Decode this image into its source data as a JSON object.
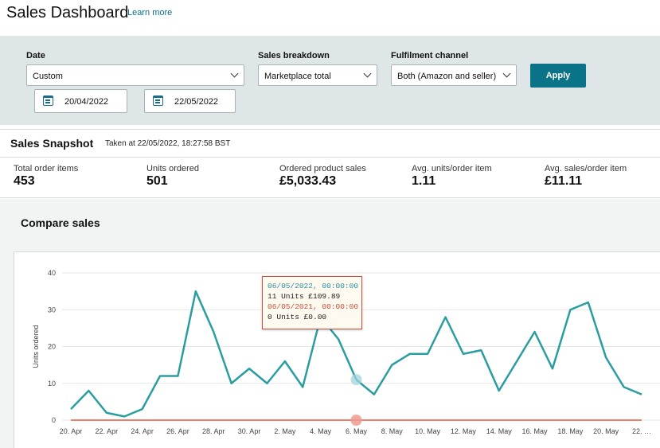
{
  "header": {
    "title": "Sales Dashboard",
    "learn_more": "Learn more"
  },
  "filters": {
    "date_label": "Date",
    "date_value": "Custom",
    "start_date": "20/04/2022",
    "end_date": "22/05/2022",
    "breakdown_label": "Sales breakdown",
    "breakdown_value": "Marketplace total",
    "channel_label": "Fulfilment channel",
    "channel_value": "Both (Amazon and seller)",
    "apply_label": "Apply"
  },
  "snapshot": {
    "title": "Sales Snapshot",
    "taken": "Taken at 22/05/2022, 18:27:58 BST",
    "metrics": [
      {
        "label": "Total order items",
        "value": "453"
      },
      {
        "label": "Units ordered",
        "value": "501"
      },
      {
        "label": "Ordered product sales",
        "value": "£5,033.43"
      },
      {
        "label": "Avg. units/order item",
        "value": "1.11"
      },
      {
        "label": "Avg. sales/order item",
        "value": "£11.11"
      }
    ]
  },
  "compare": {
    "title": "Compare sales"
  },
  "tooltip": {
    "date_current": "06/05/2022, 00:00:00",
    "value_current": "11 Units £109.89",
    "date_previous": "06/05/2021, 00:00:00",
    "value_previous": "0 Units £0.00"
  },
  "colors": {
    "current_series": "#2a9d9f",
    "previous_series": "#e0533f",
    "accent": "#0a7387"
  },
  "chart_data": {
    "type": "line",
    "ylabel": "Units ordered",
    "ylim": [
      0,
      40
    ],
    "yticks": [
      "0",
      "10",
      "20",
      "30",
      "40"
    ],
    "grid": true,
    "x": [
      "20/04",
      "21/04",
      "22/04",
      "23/04",
      "24/04",
      "25/04",
      "26/04",
      "27/04",
      "28/04",
      "29/04",
      "30/04",
      "01/05",
      "02/05",
      "03/05",
      "04/05",
      "05/05",
      "06/05",
      "07/05",
      "08/05",
      "09/05",
      "10/05",
      "11/05",
      "12/05",
      "13/05",
      "14/05",
      "15/05",
      "16/05",
      "17/05",
      "18/05",
      "19/05",
      "20/05",
      "21/05",
      "22/05"
    ],
    "xtick_labels": [
      "20. Apr",
      "22. Apr",
      "24. Apr",
      "26. Apr",
      "28. Apr",
      "30. Apr",
      "2. May",
      "4. May",
      "6. May",
      "8. May",
      "10. May",
      "12. May",
      "14. May",
      "16. May",
      "18. May",
      "20. May",
      "22. …"
    ],
    "series": [
      {
        "values": [
          3,
          8,
          2,
          1,
          3,
          12,
          12,
          35,
          24,
          10,
          14,
          10,
          16,
          9,
          28,
          22,
          11,
          7,
          15,
          18,
          18,
          28,
          18,
          19,
          8,
          16,
          24,
          14,
          30,
          32,
          17,
          9,
          7
        ]
      },
      {
        "values": [
          0,
          0,
          0,
          0,
          0,
          0,
          0,
          0,
          0,
          0,
          0,
          0,
          0,
          0,
          0,
          0,
          0,
          0,
          0,
          0,
          0,
          0,
          0,
          0,
          0,
          0,
          0,
          0,
          0,
          0,
          0,
          0,
          0
        ]
      }
    ],
    "highlight_index": 16
  }
}
